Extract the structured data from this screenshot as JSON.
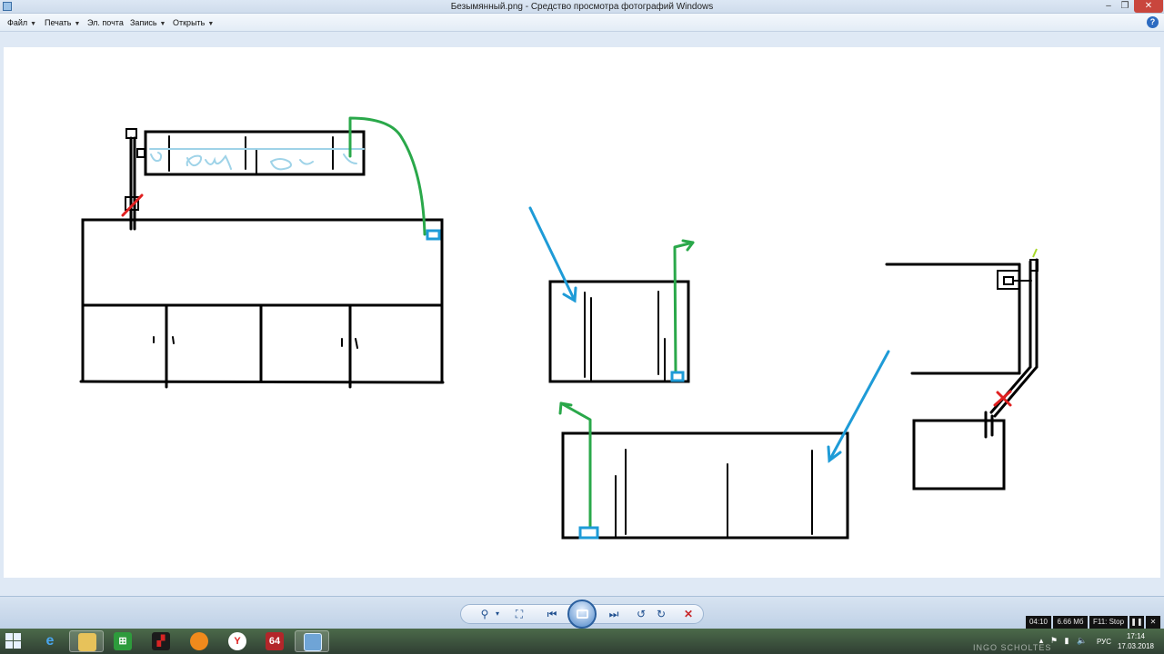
{
  "window": {
    "title": "Безымянный.png - Средство просмотра фотографий Windows",
    "min_glyph": "–",
    "max_glyph": "❐",
    "close_glyph": "✕"
  },
  "menu": {
    "file": "Файл",
    "print": "Печать",
    "email": "Эл. почта",
    "burn": "Запись",
    "open": "Открыть",
    "help_glyph": "?"
  },
  "controls": {
    "zoom_icon": "zoom-icon",
    "fit_icon": "fit-icon",
    "prev_icon": "previous-icon",
    "slideshow_icon": "slideshow-icon",
    "next_icon": "next-icon",
    "rotate_ccw_icon": "rotate-counterclockwise-icon",
    "rotate_cw_icon": "rotate-clockwise-icon",
    "delete_icon": "delete-icon",
    "delete_glyph": "✕"
  },
  "status": {
    "time": "04:10",
    "size": "6.66 Мб",
    "hint": "F11: Stop"
  },
  "taskbar": {
    "items": [
      "ie",
      "explorer",
      "store",
      "media",
      "orange",
      "yandex",
      "64",
      "photo-viewer"
    ],
    "yandex_glyph": "Y",
    "aida_glyph": "64",
    "lang": "РУС",
    "clock_time": "17:14",
    "clock_date": "17.03.2018",
    "watermark": "INGO SCHOLTES"
  },
  "colors": {
    "stroke": "#000000",
    "pipe_blue": "#1e9bd7",
    "hose_green": "#2aa84a",
    "mark_red": "#e02020",
    "water_lightblue": "#9fd3e8"
  }
}
